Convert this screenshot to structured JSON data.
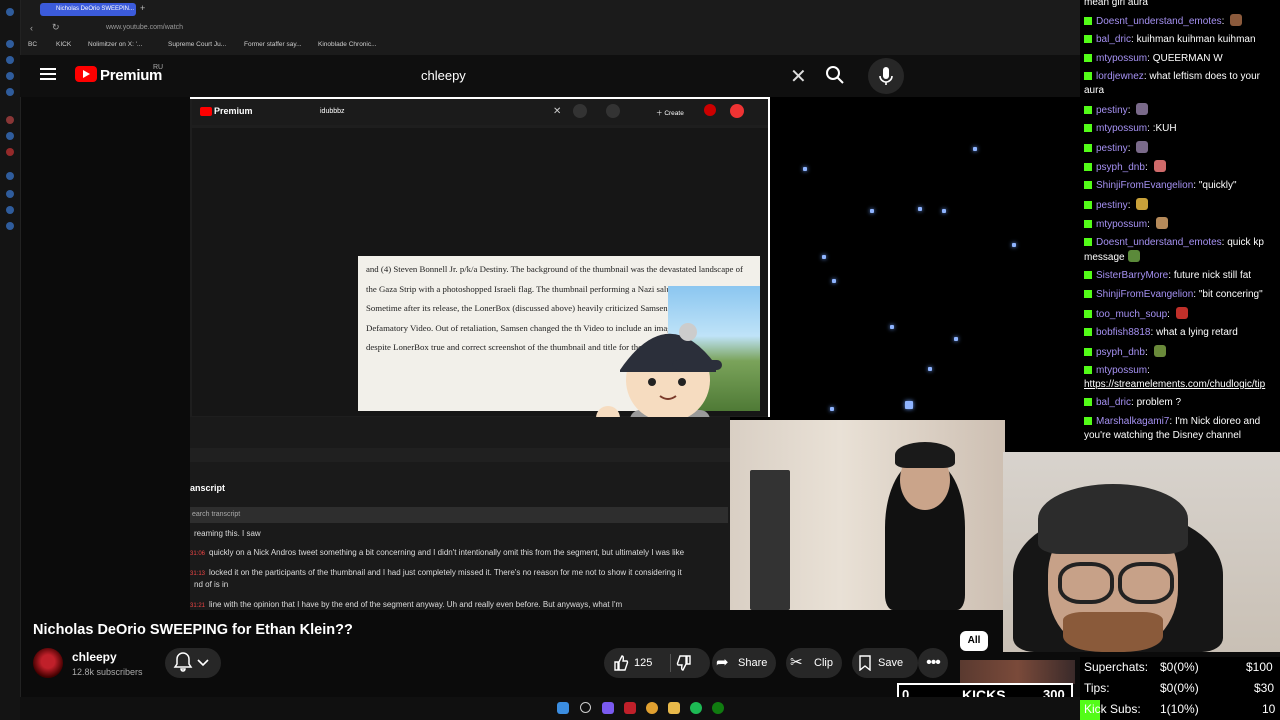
{
  "browser": {
    "tab_title": "Nicholas DeOrio SWEEPIN...",
    "url": "www.youtube.com/watch",
    "bookmarks": [
      "BC",
      "KICK",
      "Nolimitzer on X: '...",
      "Supreme Court Ju...",
      "Former staffer say...",
      "Kinoblade Chronic..."
    ]
  },
  "youtube": {
    "brand": "Premium",
    "region": "RU",
    "search_query": "chleepy"
  },
  "inner_screen": {
    "brand": "Premium",
    "search_query": "idubbbz",
    "create_label": "Create",
    "document_text": "and (4) Steven Bonnell Jr. p/k/a Destiny. The background of the thumbnail was the devastated landscape of the Gaza Strip with a photoshopped Israeli flag. The thumbnail performing a Nazi salute to the Israeli flag. Sometime after its release, the LonerBox (discussed above) heavily criticized Samsen's poor resea the Defamatory Video. Out of retaliation, Samsen changed the th Video to include an image of LonerBox – despite LonerBox true and correct screenshot of the thumbnail and title for the De",
    "transcript_title": "anscript",
    "transcript_search": "earch transcript",
    "transcript_lines": [
      {
        "ts": "",
        "text": "reaming this. I saw"
      },
      {
        "ts": "31:06",
        "text": "quickly on a Nick Andros tweet something a bit concerning and I didn't intentionally omit this from the segment, but ultimately I was like"
      },
      {
        "ts": "31:13",
        "text": "locked it on the participants of the thumbnail and I had just completely missed it. There's no reason for me not to show it considering it"
      },
      {
        "ts": "",
        "text": "nd of is in"
      },
      {
        "ts": "31:21",
        "text": "line with the opinion that I have by the end of the segment anyway. Uh and really even before. But anyways, what I'm"
      }
    ]
  },
  "video": {
    "title": "Nicholas DeOrio SWEEPING for Ethan Klein??",
    "channel": "chleepy",
    "subscribers": "12.8k subscribers",
    "likes": "125",
    "share_label": "Share",
    "clip_label": "Clip",
    "save_label": "Save",
    "chip_all": "All"
  },
  "chat": {
    "top_partial": "mean girl aura",
    "messages": [
      {
        "user": "Doesnt_understand_emotes",
        "text": "",
        "emote": "#8b5a3c"
      },
      {
        "user": "bal_dric",
        "text": "kuihman kuihman kuihman",
        "emote": ""
      },
      {
        "user": "mtypossum",
        "text": "QUEERMAN W",
        "emote": ""
      },
      {
        "user": "lordjewnez",
        "text": "what leftism does to your aura",
        "emote": ""
      },
      {
        "user": "pestiny",
        "text": "",
        "emote": "#7a6a8a"
      },
      {
        "user": "mtypossum",
        "text": ":KUH",
        "emote": ""
      },
      {
        "user": "pestiny",
        "text": "",
        "emote": "#7a6a8a"
      },
      {
        "user": "psyph_dnb",
        "text": "",
        "emote": "#d06a6a"
      },
      {
        "user": "ShinjiFromEvangelion",
        "text": "\"quickly\"",
        "emote": ""
      },
      {
        "user": "pestiny",
        "text": "",
        "emote": "#c9a13a"
      },
      {
        "user": "mtypossum",
        "text": "",
        "emote": "#b58a5a"
      },
      {
        "user": "Doesnt_understand_emotes",
        "text": "quick kp message",
        "emote": "#5b8a3a"
      },
      {
        "user": "SisterBarryMore",
        "text": "future nick still fat",
        "emote": ""
      },
      {
        "user": "ShinjiFromEvangelion",
        "text": "\"bit concering\"",
        "emote": ""
      },
      {
        "user": "too_much_soup",
        "text": "",
        "emote": "#c0302a"
      },
      {
        "user": "bobfish8818",
        "text": "what a lying retard",
        "emote": ""
      },
      {
        "user": "psyph_dnb",
        "text": "",
        "emote": "#6a8a3a"
      },
      {
        "user": "mtypossum",
        "text": "https://streamelements.com/chudlogic/tip",
        "emote": ""
      },
      {
        "user": "bal_dric",
        "text": "problem ?",
        "emote": ""
      },
      {
        "user": "Marshalkagami7",
        "text": "I'm Nick dioreo and you're watching the Disney channel",
        "emote": ""
      }
    ]
  },
  "overlay": {
    "kicks_left": "0",
    "kicks_label": "KICKS",
    "kicks_right": "300",
    "superchats_label": "Superchats:",
    "superchats_value": "$0(0%)",
    "superchats_goal": "$100",
    "tips_label": "Tips:",
    "tips_value": "$0(0%)",
    "tips_goal": "$30",
    "kicksubs_label": "Kick Subs:",
    "kicksubs_value": "1(10%)",
    "kicksubs_goal": "10",
    "kicksubs_progress": 0.1
  },
  "colors": {
    "chat_username": "#a591f2",
    "kick_green": "#53fc18",
    "yt_red": "#ff0000"
  }
}
